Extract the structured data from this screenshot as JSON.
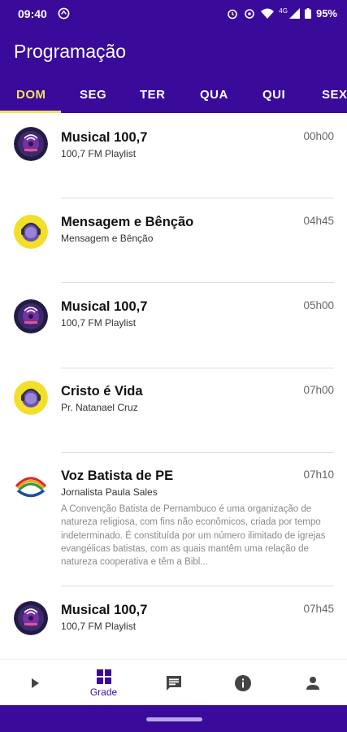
{
  "status": {
    "time": "09:40",
    "network": "4G",
    "battery": "95%"
  },
  "header": {
    "title": "Programação",
    "tabs": [
      "DOM",
      "SEG",
      "TER",
      "QUA",
      "QUI",
      "SEX"
    ],
    "active_tab": "DOM"
  },
  "schedule": [
    {
      "title": "Musical 100,7",
      "subtitle": "100,7 FM Playlist",
      "time": "00h00",
      "logo": "radio-disc-logo"
    },
    {
      "title": "Mensagem e Bênção",
      "subtitle": "Mensagem e Bênção",
      "time": "04h45",
      "logo": "yellow-mic-logo"
    },
    {
      "title": "Musical 100,7",
      "subtitle": "100,7 FM Playlist",
      "time": "05h00",
      "logo": "radio-disc-logo"
    },
    {
      "title": "Cristo é Vida",
      "subtitle": "Pr. Natanael Cruz",
      "time": "07h00",
      "logo": "yellow-mic-logo"
    },
    {
      "title": "Voz Batista de PE",
      "subtitle": "Jornalista Paula Sales",
      "time": "07h10",
      "logo": "rainbow-logo",
      "description": "A Convenção Batista de Pernambuco é uma organização de natureza religiosa, com fins não econômicos, criada por tempo indeterminado. É constituída por um número ilimitado de igrejas evangélicas batistas, com as quais mantêm uma relação de natureza cooperativa e têm a Bibl..."
    },
    {
      "title": "Musical 100,7",
      "subtitle": "100,7 FM Playlist",
      "time": "07h45",
      "logo": "radio-disc-logo"
    }
  ],
  "bottom_nav": {
    "items": [
      "play-icon",
      "grid-icon",
      "chat-icon",
      "info-icon",
      "person-icon"
    ],
    "active_label": "Grade"
  },
  "colors": {
    "primary": "#3a0a9a",
    "accent": "#f3e15b"
  }
}
